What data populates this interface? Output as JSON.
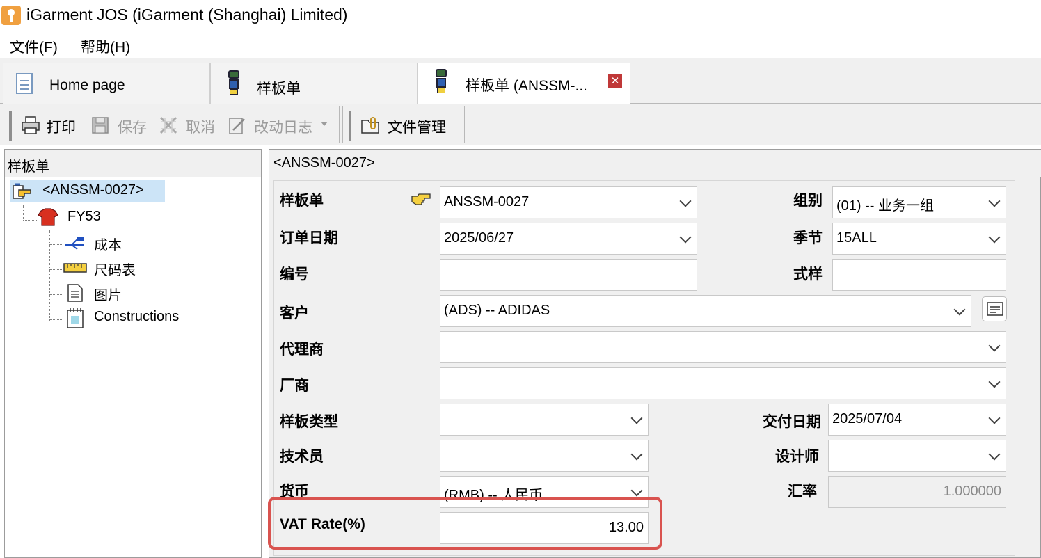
{
  "window": {
    "title": "iGarment JOS (iGarment (Shanghai) Limited)"
  },
  "menu": [
    {
      "label": "文件(F)"
    },
    {
      "label": "帮助(H)"
    }
  ],
  "tabs": [
    {
      "label": "Home page"
    },
    {
      "label": "样板单"
    },
    {
      "label": "样板单 (ANSSM-..."
    }
  ],
  "toolbar": {
    "print": "打印",
    "save": "保存",
    "cancel": "取消",
    "changelog": "改动日志",
    "file_manage": "文件管理"
  },
  "tree": {
    "title": "样板单",
    "root": "<ANSSM-0027>",
    "child": "FY53",
    "leaves": [
      "成本",
      "尺码表",
      "图片",
      "Constructions"
    ]
  },
  "form": {
    "title": "<ANSSM-0027>",
    "labels": {
      "sample_order": "样板单",
      "order_date": "订单日期",
      "number": "编号",
      "customer": "客户",
      "agent": "代理商",
      "factory": "厂商",
      "sample_type": "样板类型",
      "technician": "技术员",
      "currency": "货币",
      "vat_rate": "VAT Rate(%)",
      "group": "组别",
      "season": "季节",
      "style": "式样",
      "delivery_date": "交付日期",
      "designer": "设计师",
      "exchange_rate": "汇率"
    },
    "values": {
      "sample_order": "ANSSM-0027",
      "order_date": "2025/06/27",
      "number": "",
      "customer": "(ADS) -- ADIDAS",
      "agent": "",
      "factory": "",
      "sample_type": "",
      "technician": "",
      "currency": "(RMB) -- 人民币",
      "vat_rate": "13.00",
      "group": "(01) -- 业务一组",
      "season": "15ALL",
      "style": "",
      "delivery_date": "2025/07/04",
      "designer": "",
      "exchange_rate": "1.000000"
    }
  },
  "colors": {
    "highlight": "#d9534f",
    "tab_close": "#c03838",
    "selected_node": "#cce4f7"
  }
}
